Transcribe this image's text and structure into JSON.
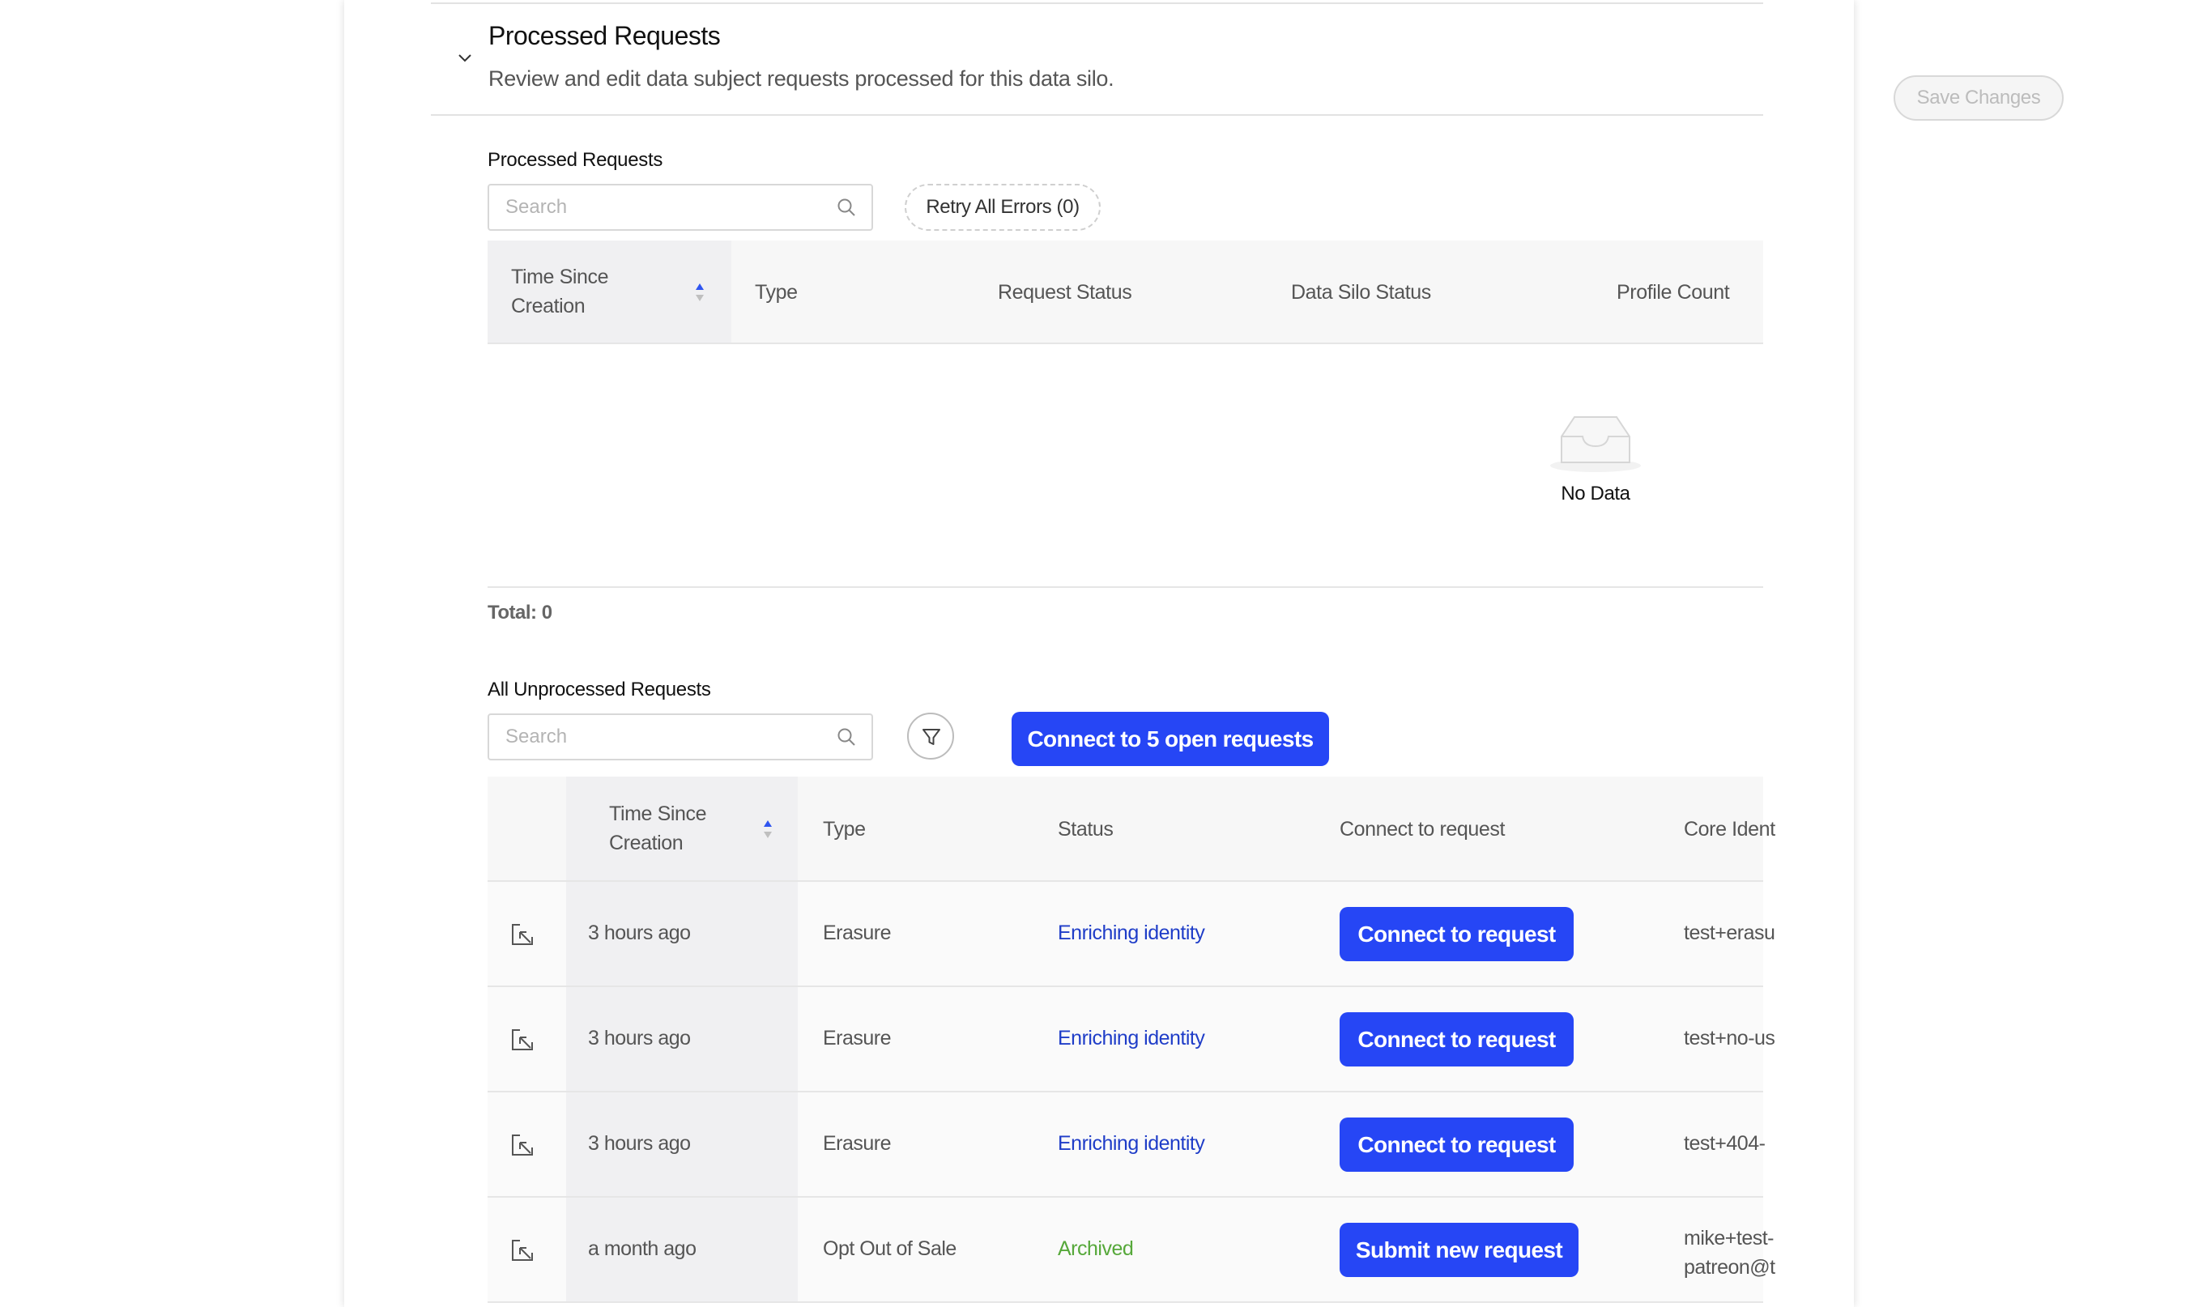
{
  "header": {
    "title": "Processed Requests",
    "description": "Review and edit data subject requests processed for this data silo."
  },
  "processed": {
    "label": "Processed Requests",
    "search_placeholder": "Search",
    "retry_button": "Retry All Errors (0)",
    "columns": [
      "Time Since\nCreation",
      "Type",
      "Request Status",
      "Data Silo Status",
      "Profile Count"
    ],
    "empty_text": "No Data",
    "total": "Total: 0"
  },
  "unprocessed": {
    "label": "All Unprocessed Requests",
    "search_placeholder": "Search",
    "connect_all_button": "Connect to 5 open requests",
    "columns": [
      "Time Since\nCreation",
      "Type",
      "Status",
      "Connect to request",
      "Core Ident"
    ],
    "rows": [
      {
        "time": "3 hours ago",
        "type": "Erasure",
        "status": "Enriching identity",
        "action": "Connect to request",
        "identity": "test+erasu"
      },
      {
        "time": "3 hours ago",
        "type": "Erasure",
        "status": "Enriching identity",
        "action": "Connect to request",
        "identity": "test+no-us"
      },
      {
        "time": "3 hours ago",
        "type": "Erasure",
        "status": "Enriching identity",
        "action": "Connect to request",
        "identity": "test+404-"
      },
      {
        "time": "a month ago",
        "type": "Opt Out of Sale",
        "status": "Archived",
        "action": "Submit new request",
        "identity": "mike+test-\npatreon@t"
      }
    ]
  },
  "save_button": "Save Changes",
  "colors": {
    "primary": "#2646f5",
    "status_enriching": "#1f3dc8",
    "status_archived": "#56a83a",
    "sort_active": "#2f55f0"
  },
  "icons": [
    "chevron-down-icon",
    "search-icon",
    "sort-icon",
    "empty-inbox-icon",
    "filter-icon",
    "open-link-icon"
  ]
}
